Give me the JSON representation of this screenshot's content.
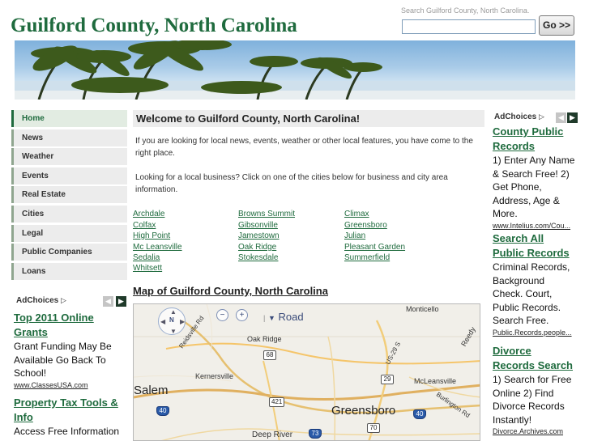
{
  "header": {
    "site_title": "Guilford County, North Carolina",
    "search_label": "Search Guilford County, North Carolina.",
    "search_value": "",
    "search_button": "Go >>"
  },
  "nav": {
    "items": [
      {
        "label": "Home",
        "active": true
      },
      {
        "label": "News"
      },
      {
        "label": "Weather"
      },
      {
        "label": "Events"
      },
      {
        "label": "Real Estate"
      },
      {
        "label": "Cities"
      },
      {
        "label": "Legal"
      },
      {
        "label": "Public Companies"
      },
      {
        "label": "Loans"
      }
    ]
  },
  "left_ads": {
    "adchoices": "AdChoices",
    "prev_icon": "◀",
    "next_icon": "▶",
    "ads": [
      {
        "title_line1": "Top 2011 Online",
        "title_line2": "Grants",
        "text_lines": [
          "Grant Funding May Be",
          "Available Go Back To",
          "School!"
        ],
        "url": "www.ClassesUSA.com"
      },
      {
        "title_line1": "Property Tax Tools &",
        "title_line2": "Info",
        "text_lines": [
          "Access Free Information"
        ],
        "url": ""
      }
    ]
  },
  "main": {
    "welcome_heading": "Welcome to Guilford County, North Carolina!",
    "intro_paragraph_1": "If you are looking for local news, events, weather or other local features, you have come to the right place.",
    "intro_paragraph_2": "Looking for a local business? Click on one of the cities below for business and city area information.",
    "cities_col1": [
      "Archdale",
      "Colfax",
      "High Point",
      "Mc Leansville",
      "Sedalia",
      "Whitsett"
    ],
    "cities_col2": [
      "Browns Summit",
      "Gibsonville",
      "Jamestown",
      "Oak Ridge",
      "Stokesdale"
    ],
    "cities_col3": [
      "Climax",
      "Greensboro",
      "Julian",
      "Pleasant Garden",
      "Summerfield"
    ],
    "map_heading": "Map of Guilford County, North Carolina"
  },
  "map": {
    "nav_n": "N",
    "zoom_out": "−",
    "zoom_in": "+",
    "map_type": "Road",
    "labels": {
      "monticello": "Monticello",
      "oak_ridge": "Oak Ridge",
      "kernersville": "Kernersville",
      "salem": "Salem",
      "greensboro": "Greensboro",
      "mcleansville": "McLeansville",
      "deep_river": "Deep River",
      "reidsville_rd": "Reidsville Rd",
      "us29": "US-29 S",
      "burlington_rd": "Burlington Rd",
      "reedy": "Reedy"
    },
    "shields": {
      "r68": "68",
      "r29": "29",
      "r421": "421",
      "r40a": "40",
      "r40b": "40",
      "r70": "70",
      "r73": "73"
    }
  },
  "right_ads": {
    "adchoices": "AdChoices",
    "prev_icon": "◀",
    "next_icon": "▶",
    "ads": [
      {
        "title_line1": "County Public",
        "title_line2": "Records",
        "text_lines": [
          "1) Enter Any Name",
          "& Search Free! 2)",
          "Get Phone,",
          "Address, Age &",
          "More."
        ],
        "url": "www.Intelius.com/Cou..."
      },
      {
        "title_line1": "Search All",
        "title_line2": "Public Records",
        "text_lines": [
          "Criminal Records,",
          "Background",
          "Check. Court,",
          "Public Records.",
          "Search Free."
        ],
        "url": "Public.Records.people..."
      },
      {
        "title_line1": "Divorce",
        "title_line2": "Records Search",
        "text_lines": [
          "1) Search for Free",
          "Online 2) Find",
          "Divorce Records",
          "Instantly!"
        ],
        "url": "Divorce.Archives.com"
      }
    ]
  }
}
